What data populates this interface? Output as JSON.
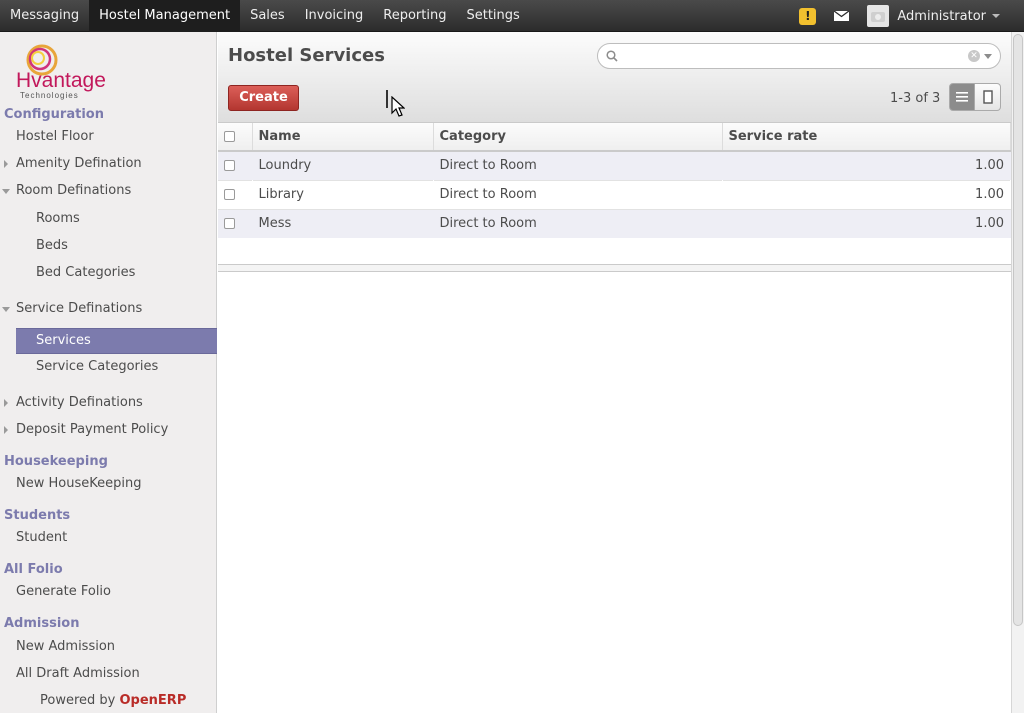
{
  "topbar": {
    "menu": [
      {
        "label": "Messaging"
      },
      {
        "label": "Hostel Management"
      },
      {
        "label": "Sales"
      },
      {
        "label": "Invoicing"
      },
      {
        "label": "Reporting"
      },
      {
        "label": "Settings"
      }
    ],
    "active_menu": "Hostel Management",
    "warning_glyph": "!",
    "user": "Administrator"
  },
  "sidebar": {
    "logo": {
      "brand": "Hvantage",
      "sub": "Technologies"
    },
    "sections": {
      "configuration": "Configuration",
      "housekeeping": "Housekeeping",
      "students": "Students",
      "all_folio": "All Folio",
      "admission": "Admission"
    },
    "items": {
      "hostel_floor": "Hostel Floor",
      "amenity_defination": "Amenity Defination",
      "room_definations": "Room Definations",
      "rooms": "Rooms",
      "beds": "Beds",
      "bed_categories": "Bed Categories",
      "service_definations": "Service Definations",
      "services": "Services",
      "service_categories": "Service Categories",
      "activity_definations": "Activity Definations",
      "deposit_payment_policy": "Deposit Payment Policy",
      "new_housekeeping": "New HouseKeeping",
      "student": "Student",
      "generate_folio": "Generate Folio",
      "new_admission": "New Admission",
      "all_draft_admission": "All Draft Admission"
    },
    "powered_by": "Powered by",
    "powered_brand": "OpenERP"
  },
  "main": {
    "title": "Hostel Services",
    "create_label": "Create",
    "pager": "1-3 of 3",
    "search": {
      "value": "",
      "placeholder": ""
    },
    "columns": [
      "Name",
      "Category",
      "Service rate"
    ],
    "rows": [
      {
        "name": "Loundry",
        "category": "Direct to Room",
        "rate": "1.00"
      },
      {
        "name": "Library",
        "category": "Direct to Room",
        "rate": "1.00"
      },
      {
        "name": "Mess",
        "category": "Direct to Room",
        "rate": "1.00"
      }
    ]
  },
  "colors": {
    "accent": "#7c7bad",
    "create": "#c9302c",
    "topbar": "#3a3a3a"
  }
}
